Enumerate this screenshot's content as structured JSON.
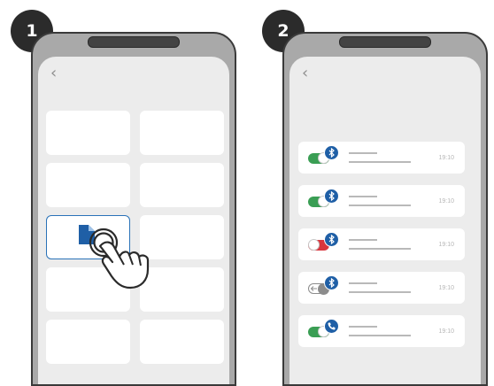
{
  "steps": {
    "step1": "1",
    "step2": "2"
  },
  "back_glyph": "‹",
  "colors": {
    "toggle_on": "#3a9e54",
    "toggle_off": "#d9363e",
    "toggle_disabled": "#8c8c8c",
    "accent_blue": "#1f5fa6",
    "selection_border": "#2a72b8"
  },
  "devices": [
    {
      "time": "19:10",
      "toggle_state": "on",
      "icon": "bluetooth-icon"
    },
    {
      "time": "19:10",
      "toggle_state": "on",
      "icon": "bluetooth-icon"
    },
    {
      "time": "19:10",
      "toggle_state": "off",
      "icon": "bluetooth-icon"
    },
    {
      "time": "19:10",
      "toggle_state": "disabled",
      "icon": "bluetooth-icon"
    },
    {
      "time": "19:10",
      "toggle_state": "on",
      "icon": "phone-icon"
    }
  ]
}
